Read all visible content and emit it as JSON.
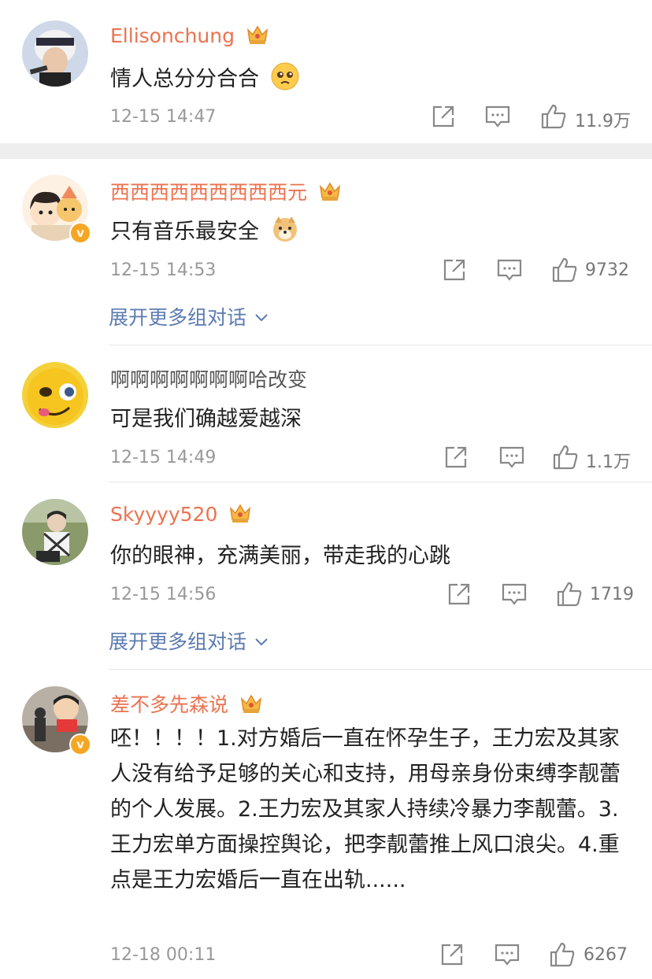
{
  "comments": [
    {
      "username": "Ellisonchung",
      "text": "情人总分分合合",
      "time": "12-15 14:47",
      "likes": "11.9万"
    },
    {
      "username": "西西西西西西西西西元",
      "text": "只有音乐最安全",
      "time": "12-15 14:53",
      "likes": "9732",
      "expand_label": "展开更多组对话"
    },
    {
      "username": "啊啊啊啊啊啊啊哈改变",
      "text": "可是我们确越爱越深",
      "time": "12-15 14:49",
      "likes": "1.1万"
    },
    {
      "username": "Skyyyy520",
      "text": "你的眼神，充满美丽，带走我的心跳",
      "time": "12-15 14:56",
      "likes": "1719",
      "expand_label": "展开更多组对话"
    },
    {
      "username": "差不多先森说",
      "text": "呸！！！！1.对方婚后一直在怀孕生子，王力宏及其家人没有给予足够的关心和支持，用母亲身份束缚李靓蕾的个人发展。2.王力宏及其家人持续冷暴力李靓蕾。3.王力宏单方面操控舆论，把李靓蕾推上风口浪尖。4.重点是王力宏婚后一直在出轨......",
      "time": "12-18 00:11",
      "likes": "6267"
    }
  ],
  "colors": {
    "vip_name": "#eb7350",
    "link": "#5b7bb0",
    "meta": "#999999",
    "verified_badge": "#f5a623"
  },
  "icons": [
    "share-icon",
    "comment-icon",
    "like-icon",
    "vip-crown-icon",
    "chevron-down-icon"
  ]
}
